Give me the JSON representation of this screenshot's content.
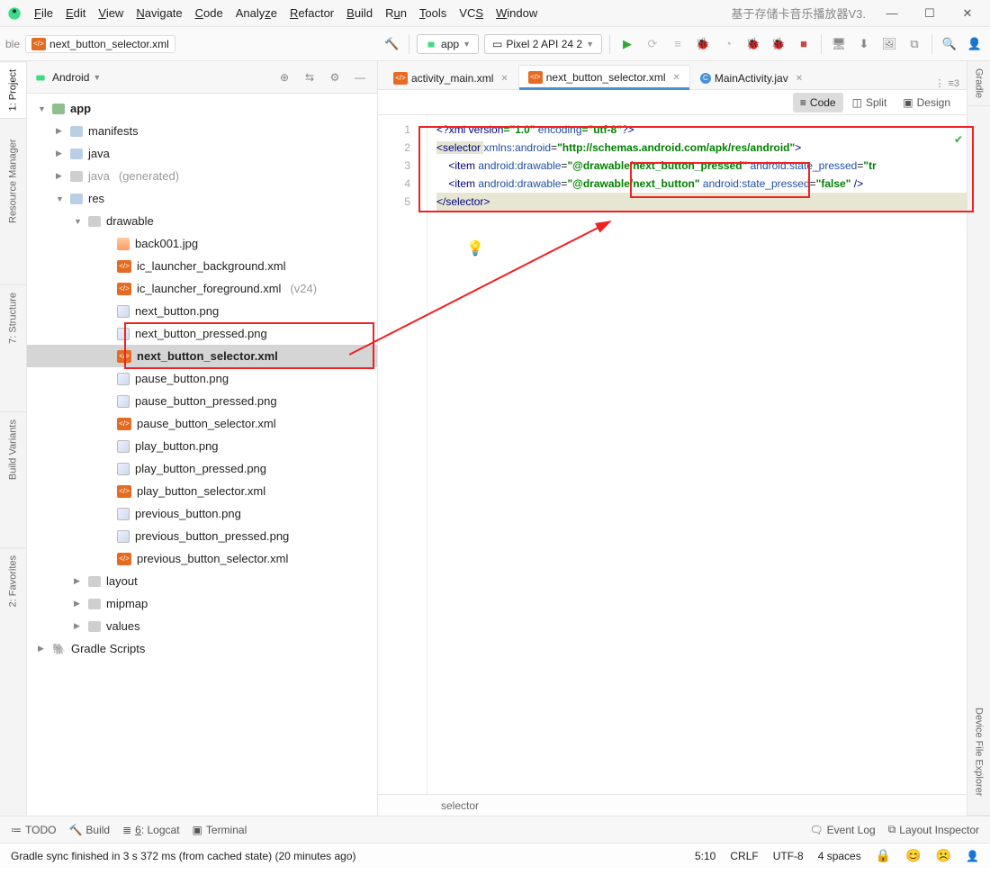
{
  "window": {
    "project_hint": "基于存储卡音乐播放器V3.",
    "menu": [
      "File",
      "Edit",
      "View",
      "Navigate",
      "Code",
      "Analyze",
      "Refactor",
      "Build",
      "Run",
      "Tools",
      "VCS",
      "Window"
    ]
  },
  "toolbar": {
    "breadcrumb_trunc": "ble",
    "breadcrumb_file": "next_button_selector.xml",
    "config_module": "app",
    "device": "Pixel 2 API 24 2"
  },
  "project": {
    "view_label": "Android",
    "root": "app",
    "nodes": {
      "manifests": "manifests",
      "java": "java",
      "java_gen": "java",
      "java_gen_suffix": "(generated)",
      "res": "res",
      "drawable": "drawable",
      "layout": "layout",
      "mipmap": "mipmap",
      "values": "values",
      "gradle": "Gradle Scripts"
    },
    "drawable_files": [
      {
        "n": "back001.jpg",
        "t": "jpg"
      },
      {
        "n": "ic_launcher_background.xml",
        "t": "xml"
      },
      {
        "n": "ic_launcher_foreground.xml",
        "t": "xml",
        "suffix": "(v24)"
      },
      {
        "n": "next_button.png",
        "t": "png"
      },
      {
        "n": "next_button_pressed.png",
        "t": "png"
      },
      {
        "n": "next_button_selector.xml",
        "t": "xml",
        "sel": true
      },
      {
        "n": "pause_button.png",
        "t": "png"
      },
      {
        "n": "pause_button_pressed.png",
        "t": "png"
      },
      {
        "n": "pause_button_selector.xml",
        "t": "xml"
      },
      {
        "n": "play_button.png",
        "t": "png"
      },
      {
        "n": "play_button_pressed.png",
        "t": "png"
      },
      {
        "n": "play_button_selector.xml",
        "t": "xml"
      },
      {
        "n": "previous_button.png",
        "t": "png"
      },
      {
        "n": "previous_button_pressed.png",
        "t": "png"
      },
      {
        "n": "previous_button_selector.xml",
        "t": "xml"
      }
    ]
  },
  "left_tabs": [
    "1: Project",
    "Resource Manager",
    "7: Structure",
    "Build Variants",
    "2: Favorites"
  ],
  "right_tabs": [
    "Gradle",
    "Device File Explorer"
  ],
  "editor": {
    "tabs": [
      {
        "label": "activity_main.xml",
        "icon": "xml"
      },
      {
        "label": "next_button_selector.xml",
        "icon": "xml",
        "active": true
      },
      {
        "label": "MainActivity.jav",
        "icon": "class"
      }
    ],
    "tabs_right": "≡3",
    "views": {
      "code": "Code",
      "split": "Split",
      "design": "Design"
    },
    "line_numbers": [
      "1",
      "2",
      "3",
      "4",
      "5"
    ],
    "code": {
      "l1a": "<?",
      "l1b": "xml version",
      "l1c": "=\"1.0\"",
      "l1d": " encoding",
      "l1e": "=\"utf-8\"",
      "l1f": "?>",
      "l2a": "<",
      "l2b": "selector ",
      "l2c": "xmlns:android",
      "l2d": "=",
      "l2e": "\"http://schemas.android.com/apk/res/android\"",
      "l2f": ">",
      "l3a": "    <",
      "l3b": "item ",
      "l3c": "android:drawable",
      "l3d": "=",
      "l3e": "\"",
      "l3f": "@drawable/next_button_pressed",
      "l3g": "\"",
      "l3h": " android:state_pressed",
      "l3i": "=",
      "l3j": "\"tr",
      "l4a": "    <",
      "l4b": "item ",
      "l4c": "android:drawable",
      "l4d": "=",
      "l4e": "\"",
      "l4f": "@drawable/next_button",
      "l4g": "\"",
      "l4h": " android:state_pressed",
      "l4i": "=",
      "l4j": "\"false\"",
      "l4k": " />",
      "l5a": "</",
      "l5b": "selector",
      "l5c": ">"
    },
    "crumb": "selector"
  },
  "bottom": {
    "todo": "TODO",
    "build": "Build",
    "logcat": "6: Logcat",
    "terminal": "Terminal",
    "eventlog": "Event Log",
    "layoutinsp": "Layout Inspector"
  },
  "status": {
    "msg": "Gradle sync finished in 3 s 372 ms (from cached state) (20 minutes ago)",
    "pos": "5:10",
    "crlf": "CRLF",
    "enc": "UTF-8",
    "indent": "4 spaces"
  }
}
